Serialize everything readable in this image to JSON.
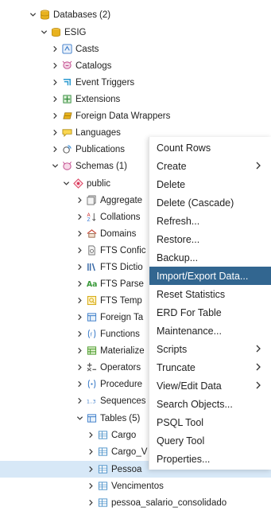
{
  "tree": {
    "rows": [
      {
        "label": "Databases",
        "count": "(2)",
        "expanded": true,
        "icon": "databases-icon"
      },
      {
        "label": "ESIG",
        "expanded": true,
        "icon": "database-icon"
      },
      {
        "label": "Casts",
        "icon": "casts-icon"
      },
      {
        "label": "Catalogs",
        "icon": "catalogs-icon"
      },
      {
        "label": "Event Triggers",
        "icon": "event-triggers-icon"
      },
      {
        "label": "Extensions",
        "icon": "extensions-icon"
      },
      {
        "label": "Foreign Data Wrappers",
        "icon": "foreign-data-wrappers-icon"
      },
      {
        "label": "Languages",
        "icon": "languages-icon"
      },
      {
        "label": "Publications",
        "icon": "publications-icon"
      },
      {
        "label": "Schemas",
        "count": "(1)",
        "expanded": true,
        "icon": "schemas-icon"
      },
      {
        "label": "public",
        "expanded": true,
        "icon": "schema-icon"
      },
      {
        "label": "Aggregate",
        "icon": "aggregates-icon"
      },
      {
        "label": "Collations",
        "icon": "collations-icon"
      },
      {
        "label": "Domains",
        "icon": "domains-icon"
      },
      {
        "label": "FTS Confic",
        "icon": "fts-configurations-icon"
      },
      {
        "label": "FTS Dictio",
        "icon": "fts-dictionaries-icon"
      },
      {
        "label": "FTS Parse",
        "icon": "fts-parsers-icon"
      },
      {
        "label": "FTS Temp",
        "icon": "fts-templates-icon"
      },
      {
        "label": "Foreign Ta",
        "icon": "foreign-tables-icon"
      },
      {
        "label": "Functions",
        "icon": "functions-icon"
      },
      {
        "label": "Materialize",
        "icon": "materialized-views-icon"
      },
      {
        "label": "Operators",
        "icon": "operators-icon"
      },
      {
        "label": "Procedure",
        "icon": "procedures-icon"
      },
      {
        "label": "Sequences",
        "icon": "sequences-icon"
      },
      {
        "label": "Tables",
        "count": "(5)",
        "expanded": true,
        "icon": "tables-icon"
      },
      {
        "label": "Cargo",
        "icon": "table-icon"
      },
      {
        "label": "Cargo_V",
        "icon": "table-icon"
      },
      {
        "label": "Pessoa",
        "icon": "table-icon",
        "selected": true
      },
      {
        "label": "Vencimentos",
        "icon": "table-icon"
      },
      {
        "label": "pessoa_salario_consolidado",
        "icon": "table-icon"
      }
    ]
  },
  "context_menu": {
    "items": [
      {
        "label": "Count Rows"
      },
      {
        "label": "Create",
        "submenu": true
      },
      {
        "label": "Delete"
      },
      {
        "label": "Delete (Cascade)"
      },
      {
        "label": "Refresh..."
      },
      {
        "label": "Restore..."
      },
      {
        "label": "Backup..."
      },
      {
        "label": "Import/Export Data...",
        "active": true
      },
      {
        "label": "Reset Statistics"
      },
      {
        "label": "ERD For Table"
      },
      {
        "label": "Maintenance..."
      },
      {
        "label": "Scripts",
        "submenu": true
      },
      {
        "label": "Truncate",
        "submenu": true
      },
      {
        "label": "View/Edit Data",
        "submenu": true
      },
      {
        "label": "Search Objects..."
      },
      {
        "label": "PSQL Tool"
      },
      {
        "label": "Query Tool"
      },
      {
        "label": "Properties..."
      }
    ]
  },
  "colors": {
    "menu_active_bg": "#326690",
    "selected_row_bg": "#d7e8f7",
    "database_gold": "#e8b21e",
    "schema_pink": "#d04f8a",
    "table_blue": "#4a90c8"
  }
}
